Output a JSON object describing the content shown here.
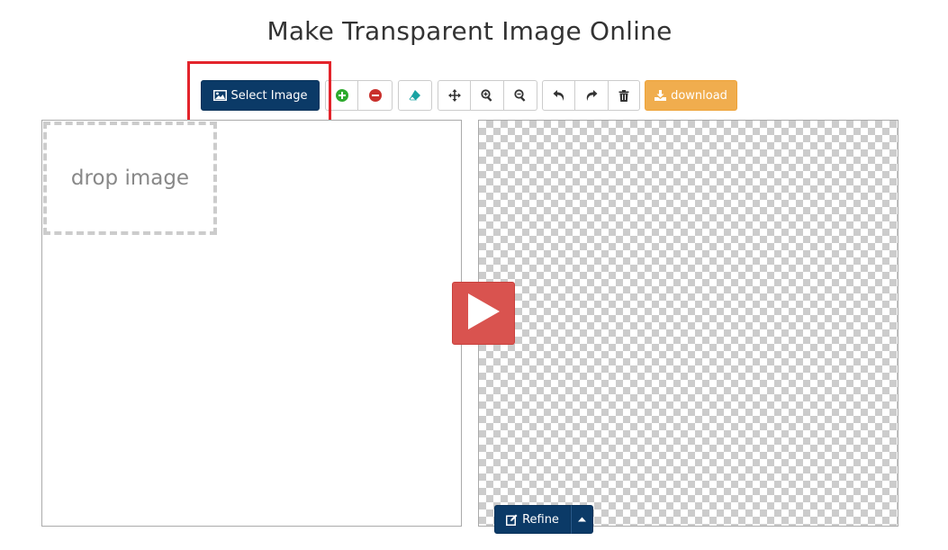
{
  "page": {
    "title": "Make Transparent Image Online"
  },
  "toolbar": {
    "select_image_label": "Select Image",
    "download_label": "download"
  },
  "left_panel": {
    "drop_text": "drop image"
  },
  "refine": {
    "label": "Refine"
  },
  "colors": {
    "primary": "#0b3a67",
    "warning": "#f0ad4e",
    "danger": "#d9534f",
    "highlight": "#e3242b",
    "add": "#2eaa2e",
    "remove": "#c9302c",
    "eraser": "#1aa3a3"
  },
  "icons": {
    "select": "image-icon",
    "add": "plus-circle-icon",
    "remove": "minus-circle-icon",
    "eraser": "eraser-icon",
    "move": "move-icon",
    "zoom_in": "zoom-in-icon",
    "zoom_out": "zoom-out-icon",
    "undo": "undo-icon",
    "redo": "redo-icon",
    "trash": "trash-icon",
    "download": "download-icon",
    "play": "play-icon",
    "edit": "edit-icon",
    "caret": "caret-up-icon"
  }
}
